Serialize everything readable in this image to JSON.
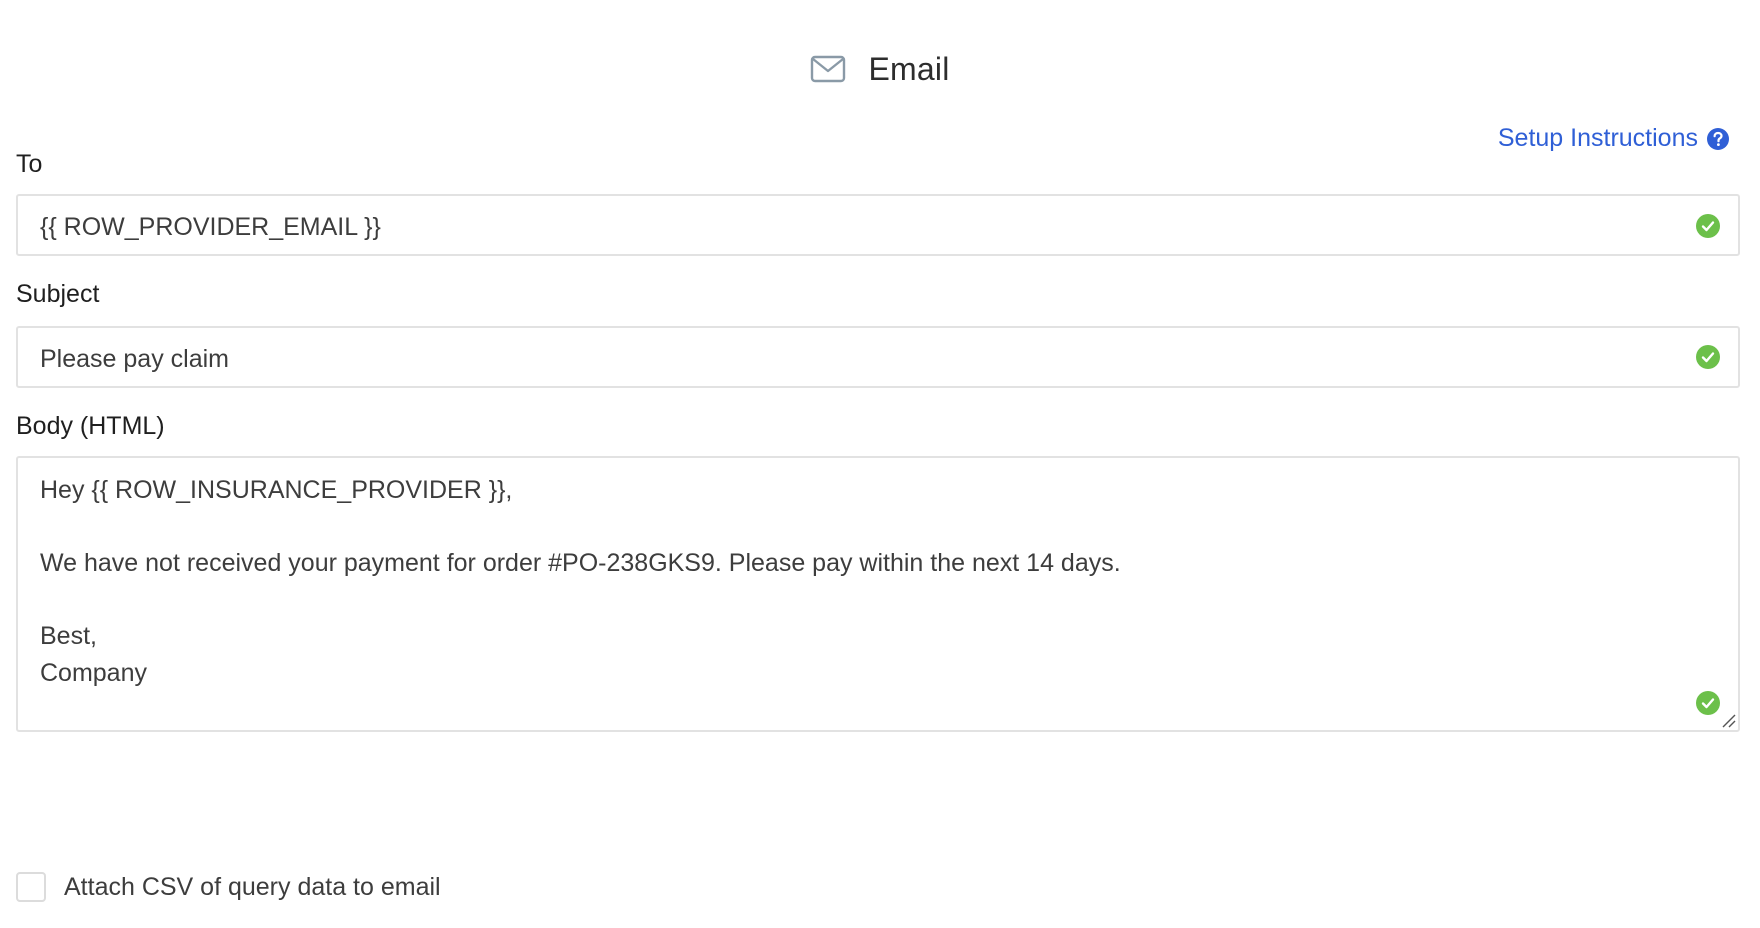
{
  "header": {
    "title": "Email",
    "icon": "envelope-icon"
  },
  "setup_link": {
    "label": "Setup Instructions",
    "icon": "question-circle-icon",
    "color": "#2f5fd6"
  },
  "fields": {
    "to": {
      "label": "To",
      "value": "{{ ROW_PROVIDER_EMAIL }}",
      "status_icon": "check-circle-icon"
    },
    "subject": {
      "label": "Subject",
      "value": "Please pay claim",
      "status_icon": "check-circle-icon"
    },
    "body": {
      "label": "Body (HTML)",
      "lines": [
        "Hey {{ ROW_INSURANCE_PROVIDER }},",
        "",
        "We have not received your payment for order #PO-238GKS9. Please pay within the next 14 days.",
        "",
        "Best,",
        "Company"
      ],
      "status_icon": "check-circle-icon"
    }
  },
  "attach_csv": {
    "label": "Attach CSV of query data to email",
    "checked": false
  },
  "colors": {
    "valid": "#6cc04a",
    "link": "#2f5fd6",
    "border": "#e2e2e2"
  }
}
